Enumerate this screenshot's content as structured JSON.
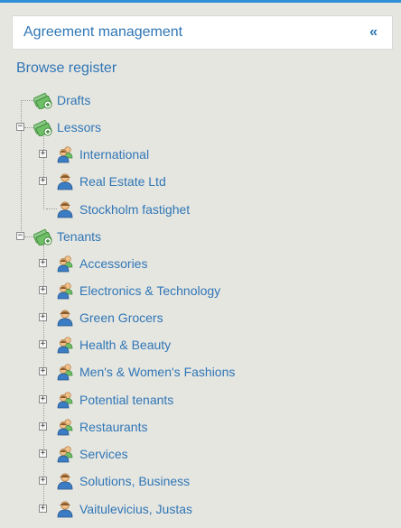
{
  "header": {
    "title": "Agreement management",
    "collapse_icon": "double-chevron-left-icon"
  },
  "browse_label": "Browse register",
  "tree": {
    "drafts": "Drafts",
    "lessors": {
      "label": "Lessors",
      "children": [
        "International",
        "Real Estate Ltd",
        "Stockholm fastighet"
      ]
    },
    "tenants": {
      "label": "Tenants",
      "children": [
        "Accessories",
        "Electronics & Technology",
        "Green Grocers",
        "Health & Beauty",
        "Men's & Women's Fashions",
        "Potential tenants",
        "Restaurants",
        "Services",
        "Solutions, Business",
        "Vaitulevicius, Justas"
      ]
    }
  },
  "colors": {
    "accent": "#2f76b5",
    "topbar": "#2e8fd6",
    "background": "#e6e6e1"
  }
}
